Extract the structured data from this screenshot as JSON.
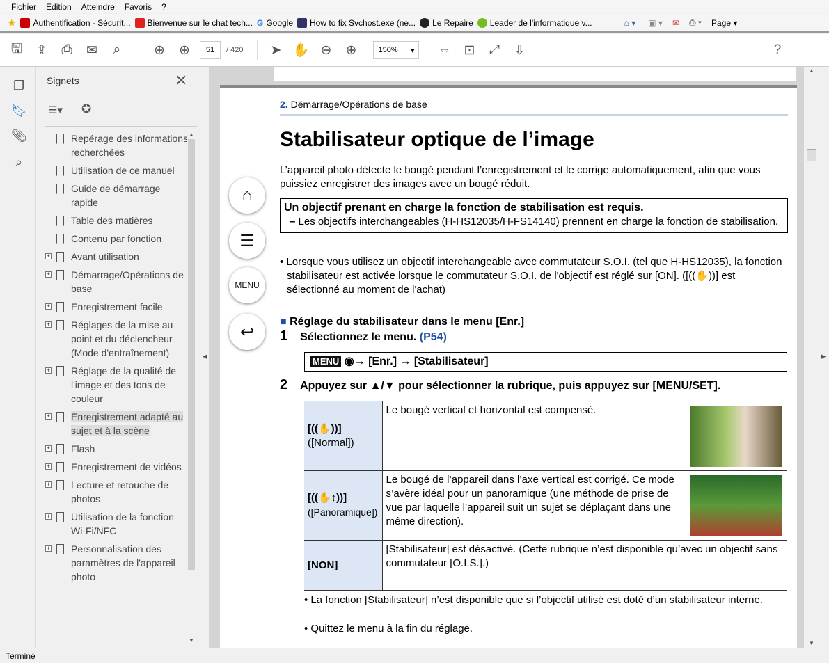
{
  "menu": [
    "Fichier",
    "Edition",
    "Atteindre",
    "Favoris",
    "?"
  ],
  "favorites": [
    "Authentification - Sécurit...",
    "Bienvenue sur le chat tech...",
    "Google",
    "How to fix Svchost.exe (ne...",
    "Le Repaire",
    "Leader de l'informatique v..."
  ],
  "ie_page_label": "Page",
  "toolbar": {
    "page_current": "51",
    "page_total": "/ 420",
    "zoom": "150%"
  },
  "panel": {
    "title": "Signets",
    "bookmarks": [
      {
        "label": "Repérage des informations recherchées",
        "expandable": false
      },
      {
        "label": "Utilisation de ce manuel",
        "expandable": false
      },
      {
        "label": "Guide de démarrage rapide",
        "expandable": false
      },
      {
        "label": "Table des matières",
        "expandable": false
      },
      {
        "label": "Contenu par fonction",
        "expandable": false
      },
      {
        "label": "Avant utilisation",
        "expandable": true
      },
      {
        "label": "Démarrage/Opérations de base",
        "expandable": true
      },
      {
        "label": "Enregistrement facile",
        "expandable": true
      },
      {
        "label": "Réglages de la mise au point et du déclencheur (Mode d'entraînement)",
        "expandable": true
      },
      {
        "label": "Réglage de la qualité de l'image et des tons de couleur",
        "expandable": true
      },
      {
        "label": "Enregistrement adapté au sujet et à la scène",
        "expandable": true,
        "selected": true
      },
      {
        "label": "Flash",
        "expandable": true
      },
      {
        "label": "Enregistrement de vidéos",
        "expandable": true
      },
      {
        "label": "Lecture et retouche de photos",
        "expandable": true
      },
      {
        "label": "Utilisation de la fonction Wi-Fi/NFC",
        "expandable": true
      },
      {
        "label": "Personnalisation des paramètres de l'appareil photo",
        "expandable": true
      }
    ]
  },
  "nav": {
    "menu_label": "MENU"
  },
  "doc": {
    "chapter_num": "2.",
    "chapter": "Démarrage/Opérations de base",
    "title": "Stabilisateur optique de l’image",
    "intro": "L’appareil photo détecte le bougé pendant l’enregistrement et le corrige automatiquement, afin que vous puissiez enregistrer des images avec un bougé réduit.",
    "box_title": "Un objectif prenant en charge la fonction de stabilisation est requis.",
    "box_item": "Les objectifs interchangeables (H-HS12035/H-FS14140) prennent en charge la fonction de stabilisation.",
    "note": "• Lorsque vous utilisez un objectif interchangeable avec commutateur S.O.I. (tel que H-HS12035), la fonction stabilisateur est activée lorsque le commutateur S.O.I. de l'objectif est réglé sur [ON]. ([((✋))] est sélectionné au moment de l'achat)",
    "section": "Réglage du stabilisateur dans le menu [Enr.]",
    "step1_num": "1",
    "step1": "Sélectionnez le menu.",
    "step1_link": "(P54)",
    "menu_badge": "MENU",
    "menu_path": "→    [Enr.] → [Stabilisateur]",
    "step2_num": "2",
    "step2": "Appuyez sur ▲/▼ pour sélectionner la rubrique, puis appuyez sur [MENU/SET].",
    "rows": [
      {
        "icon": "[((✋))]",
        "name": "([Normal])",
        "desc": "Le bougé vertical et horizontal est compensé."
      },
      {
        "icon": "[((✋↕))]",
        "name": "([Panoramique])",
        "desc": "Le bougé de l’appareil dans l’axe vertical est corrigé. Ce mode s’avère idéal pour un panoramique (une méthode de prise de vue par laquelle l’appareil suit un sujet se déplaçant dans une même direction)."
      },
      {
        "icon": "[NON]",
        "name": "",
        "desc": "[Stabilisateur] est désactivé. (Cette rubrique n’est disponible qu’avec un objectif sans commutateur [O.I.S.].)"
      }
    ],
    "bullet1": "La fonction [Stabilisateur] n’est disponible que si l’objectif utilisé est doté d’un stabilisateur interne.",
    "bullet2": "Quittez le menu à la fin du réglage."
  },
  "status": "Terminé",
  "colors": {
    "accent": "#1f4fa0",
    "table_header": "#dce6f5"
  }
}
